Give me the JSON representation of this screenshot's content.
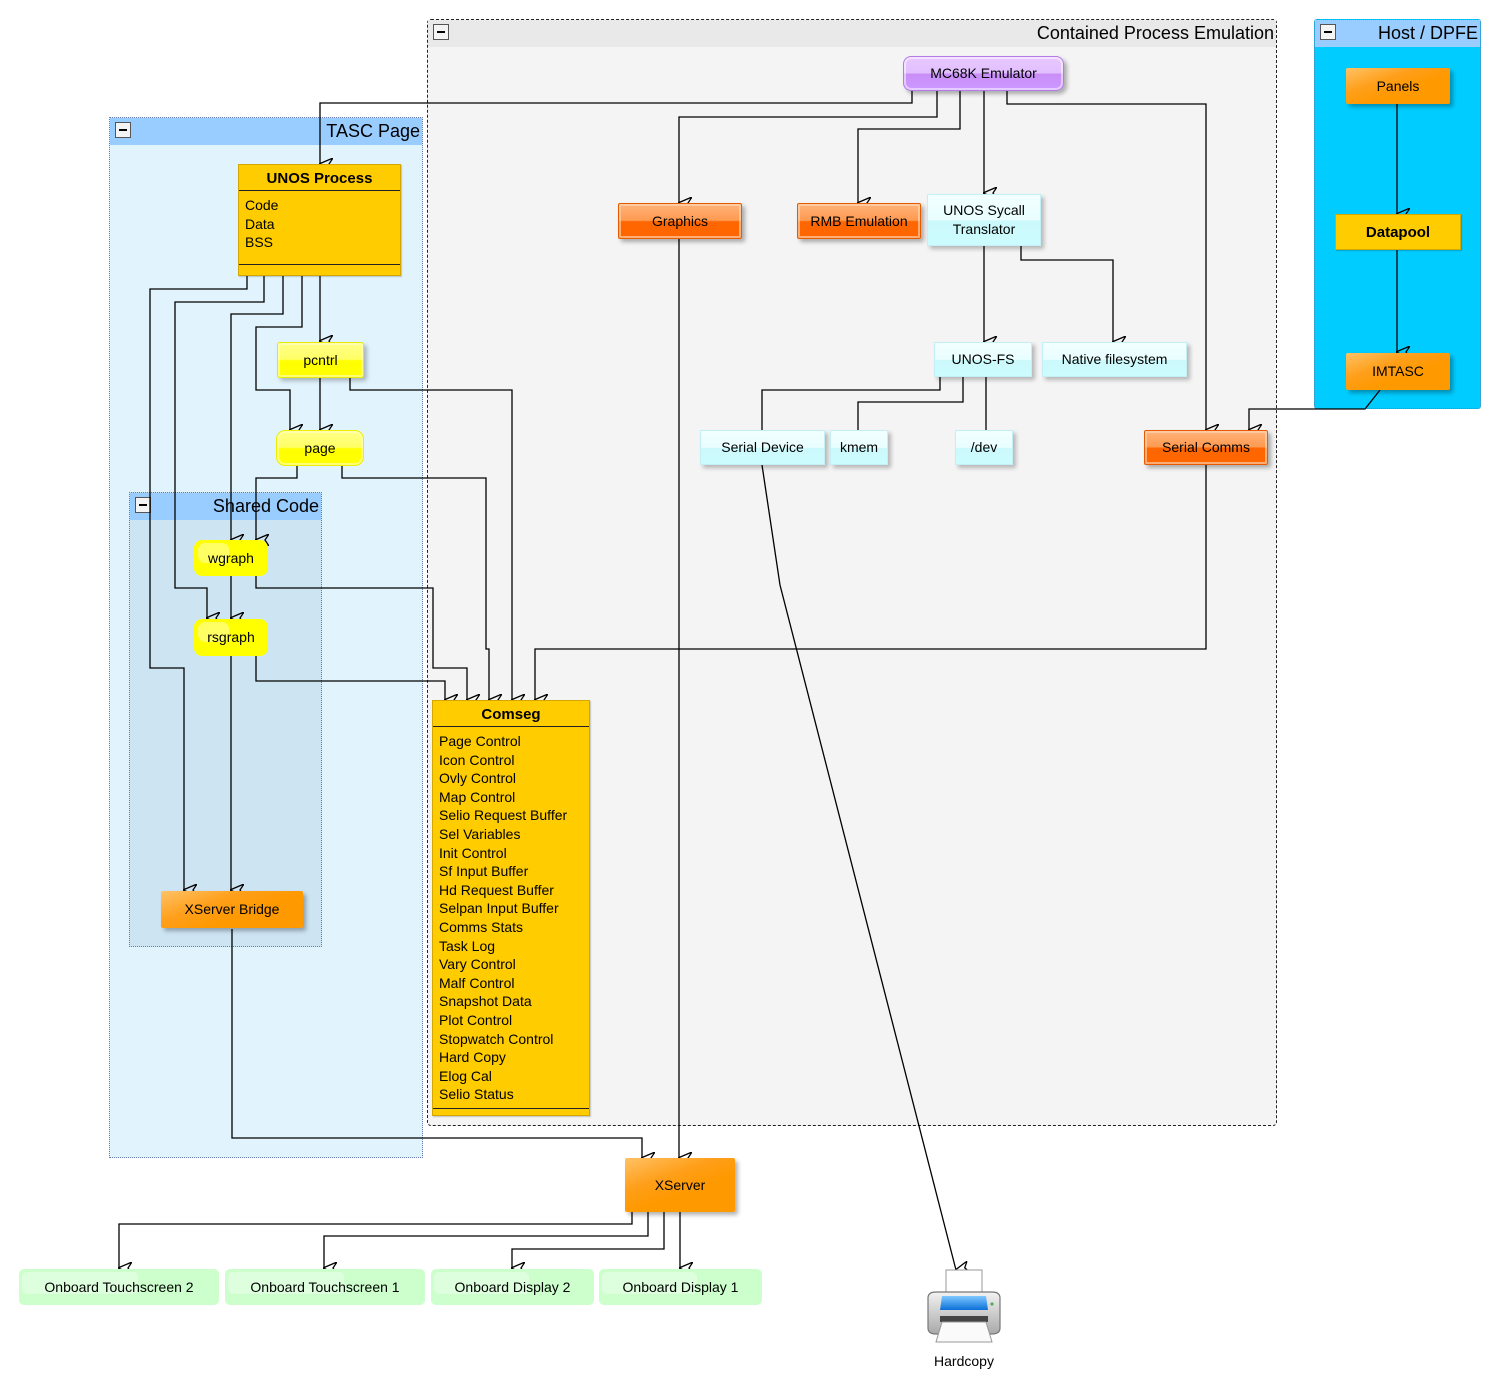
{
  "groups": {
    "contained_process_emulation": {
      "title": "Contained Process Emulation"
    },
    "host_dpfe": {
      "title": "Host / DPFE"
    },
    "tasc_page": {
      "title": "TASC Page"
    },
    "shared_code": {
      "title": "Shared Code"
    }
  },
  "nodes": {
    "mc68k_emulator": "MC68K Emulator",
    "graphics": "Graphics",
    "rmb_emulation": "RMB Emulation",
    "unos_syscall_translator": "UNOS Sycall Translator",
    "unos_fs": "UNOS-FS",
    "native_filesystem": "Native filesystem",
    "serial_device": "Serial Device",
    "kmem": "kmem",
    "dev": "/dev",
    "serial_comms": "Serial Comms",
    "panels": "Panels",
    "datapool": "Datapool",
    "imtasc": "IMTASC",
    "pcntrl": "pcntrl",
    "page": "page",
    "wgraph": "wgraph",
    "rsgraph": "rsgraph",
    "xserver_bridge": "XServer Bridge",
    "xserver": "XServer",
    "onboard_touchscreen_2": "Onboard Touchscreen 2",
    "onboard_touchscreen_1": "Onboard Touchscreen 1",
    "onboard_display_2": "Onboard Display 2",
    "onboard_display_1": "Onboard Display 1",
    "hardcopy": "Hardcopy"
  },
  "classes": {
    "unos_process": {
      "title": "UNOS Process",
      "attributes": [
        "Code",
        "Data",
        "BSS"
      ]
    },
    "comseg": {
      "title": "Comseg",
      "attributes": [
        "Page Control",
        "Icon Control",
        "Ovly Control",
        "Map Control",
        "Selio Request Buffer",
        "Sel Variables",
        "Init Control",
        "Sf Input Buffer",
        "Hd Request Buffer",
        "Selpan Input Buffer",
        "Comms Stats",
        "Task Log",
        "Vary Control",
        "Malf Control",
        "Snapshot Data",
        "Plot Control",
        "Stopwatch Control",
        "Hard Copy",
        "Elog Cal",
        "Selio Status"
      ]
    }
  },
  "edges": [
    {
      "from": "MC68K Emulator",
      "to": "UNOS Process"
    },
    {
      "from": "MC68K Emulator",
      "to": "Graphics"
    },
    {
      "from": "MC68K Emulator",
      "to": "RMB Emulation"
    },
    {
      "from": "MC68K Emulator",
      "to": "UNOS Sycall Translator"
    },
    {
      "from": "MC68K Emulator",
      "to": "Serial Comms"
    },
    {
      "from": "UNOS Sycall Translator",
      "to": "UNOS-FS"
    },
    {
      "from": "UNOS Sycall Translator",
      "to": "Native filesystem"
    },
    {
      "from": "UNOS-FS",
      "to": "Serial Device",
      "arrow": false
    },
    {
      "from": "UNOS-FS",
      "to": "kmem",
      "arrow": false
    },
    {
      "from": "UNOS-FS",
      "to": "/dev",
      "arrow": false
    },
    {
      "from": "Serial Device",
      "to": "Hardcopy"
    },
    {
      "from": "Panels",
      "to": "Datapool"
    },
    {
      "from": "Datapool",
      "to": "IMTASC"
    },
    {
      "from": "IMTASC",
      "to": "Serial Comms"
    },
    {
      "from": "Serial Comms",
      "to": "Comseg"
    },
    {
      "from": "UNOS Process",
      "to": "pcntrl"
    },
    {
      "from": "UNOS Process",
      "to": "page"
    },
    {
      "from": "UNOS Process",
      "to": "wgraph"
    },
    {
      "from": "UNOS Process",
      "to": "rsgraph"
    },
    {
      "from": "UNOS Process",
      "to": "XServer Bridge"
    },
    {
      "from": "pcntrl",
      "to": "page"
    },
    {
      "from": "pcntrl",
      "to": "Comseg"
    },
    {
      "from": "page",
      "to": "wgraph"
    },
    {
      "from": "page",
      "to": "Comseg"
    },
    {
      "from": "wgraph",
      "to": "rsgraph"
    },
    {
      "from": "wgraph",
      "to": "Comseg"
    },
    {
      "from": "rsgraph",
      "to": "Comseg"
    },
    {
      "from": "rsgraph",
      "to": "XServer Bridge"
    },
    {
      "from": "Graphics",
      "to": "XServer"
    },
    {
      "from": "XServer Bridge",
      "to": "XServer"
    },
    {
      "from": "XServer",
      "to": "Onboard Touchscreen 2"
    },
    {
      "from": "XServer",
      "to": "Onboard Touchscreen 1"
    },
    {
      "from": "XServer",
      "to": "Onboard Display 2"
    },
    {
      "from": "XServer",
      "to": "Onboard Display 1"
    }
  ]
}
